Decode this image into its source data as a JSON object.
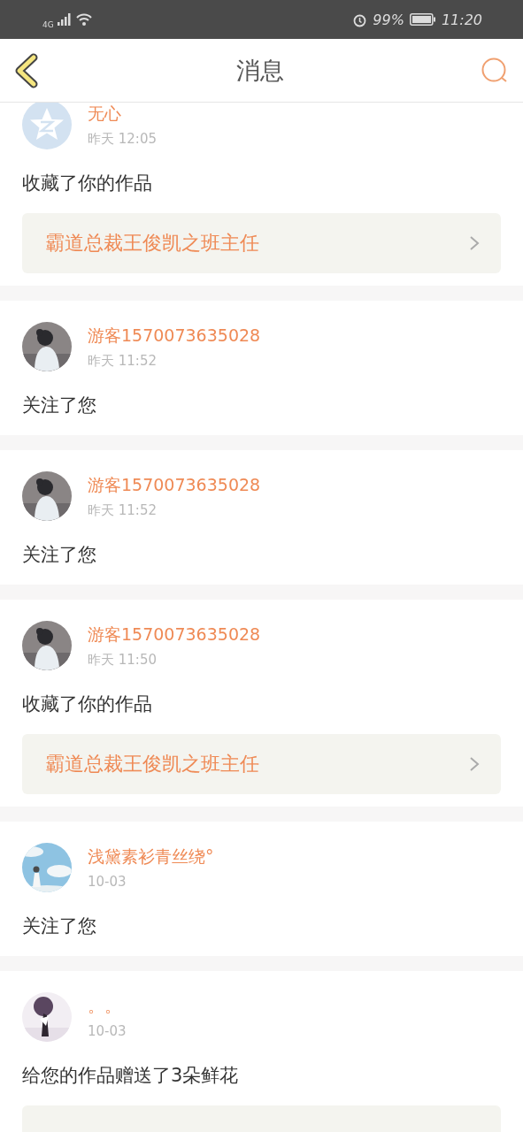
{
  "status_bar": {
    "network": "4G",
    "battery": "99%",
    "time": "11:20"
  },
  "header": {
    "title": "消息"
  },
  "messages": [
    {
      "avatar": {
        "kind": "default"
      },
      "name": "无心",
      "time": "昨天 12:05",
      "text": "收藏了你的作品",
      "work": "霸道总裁王俊凯之班主任"
    },
    {
      "name": "游客1570073635028",
      "time": "昨天 11:52",
      "text": "关注了您"
    },
    {
      "name": "游客1570073635028",
      "time": "昨天 11:52",
      "text": "关注了您"
    },
    {
      "name": "游客1570073635028",
      "time": "昨天 11:50",
      "text": "收藏了你的作品",
      "work": "霸道总裁王俊凯之班主任"
    },
    {
      "avatar": {
        "kind": "sky"
      },
      "name": "浅黛素衫青丝绕°",
      "time": "10-03",
      "text": "关注了您"
    },
    {
      "avatar": {
        "kind": "light"
      },
      "name": "。。",
      "time": "10-03",
      "text": "给您的作品赠送了3朵鲜花",
      "work_cut": true
    }
  ]
}
